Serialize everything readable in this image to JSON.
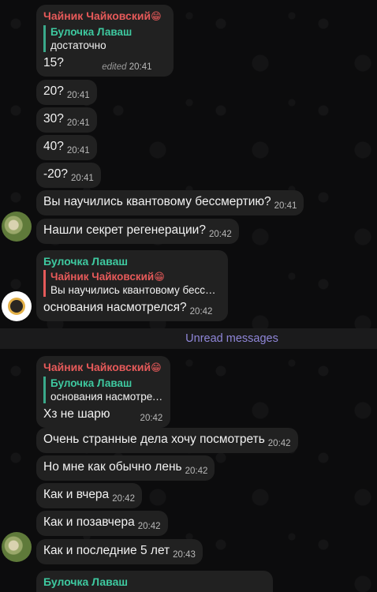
{
  "messages": [
    {
      "sender": "Чайник   Чайковский",
      "sender_emoji": "😁",
      "reply_name": "Булочка Лаваш",
      "reply_text": "достаточно",
      "text": "15?",
      "edited": "edited",
      "time": "20:41"
    },
    {
      "text": "20?",
      "time": "20:41"
    },
    {
      "text": "30?",
      "time": "20:41"
    },
    {
      "text": "40?",
      "time": "20:41"
    },
    {
      "text": "-20?",
      "time": "20:41"
    },
    {
      "text": "Вы научились квантовому бессмертию?",
      "time": "20:41"
    },
    {
      "text": "Нашли секрет регенерации?",
      "time": "20:42"
    },
    {
      "sender": "Булочка Лаваш",
      "reply_name": "Чайник   Чайковский",
      "reply_emoji": "😁",
      "reply_text": "Вы научились квантовому бессмертию?",
      "text": "основания насмотрелся?",
      "time": "20:42"
    },
    {
      "sender": "Чайник   Чайковский",
      "sender_emoji": "😁",
      "reply_name": "Булочка Лаваш",
      "reply_text": "основания насмотрелся?",
      "text": "Хз не шарю",
      "time": "20:42"
    },
    {
      "text": "Очень странные дела хочу посмотреть",
      "time": "20:42"
    },
    {
      "text": "Но мне как обычно лень",
      "time": "20:42"
    },
    {
      "text": "Как и вчера",
      "time": "20:42"
    },
    {
      "text": "Как и позавчера",
      "time": "20:42"
    },
    {
      "text": "Как и последние 5 лет",
      "time": "20:43"
    },
    {
      "sender": "Булочка Лаваш"
    }
  ],
  "divider": {
    "label": "Unread messages"
  },
  "avatars": [
    {
      "icon": "cat-photo-avatar"
    },
    {
      "icon": "sun-avatar"
    },
    {
      "icon": "cat-photo-avatar"
    }
  ],
  "colors": {
    "bubble": "#212121",
    "red_name": "#e75a5a",
    "green_name": "#3ec9a0",
    "unread": "#8f86d8"
  }
}
